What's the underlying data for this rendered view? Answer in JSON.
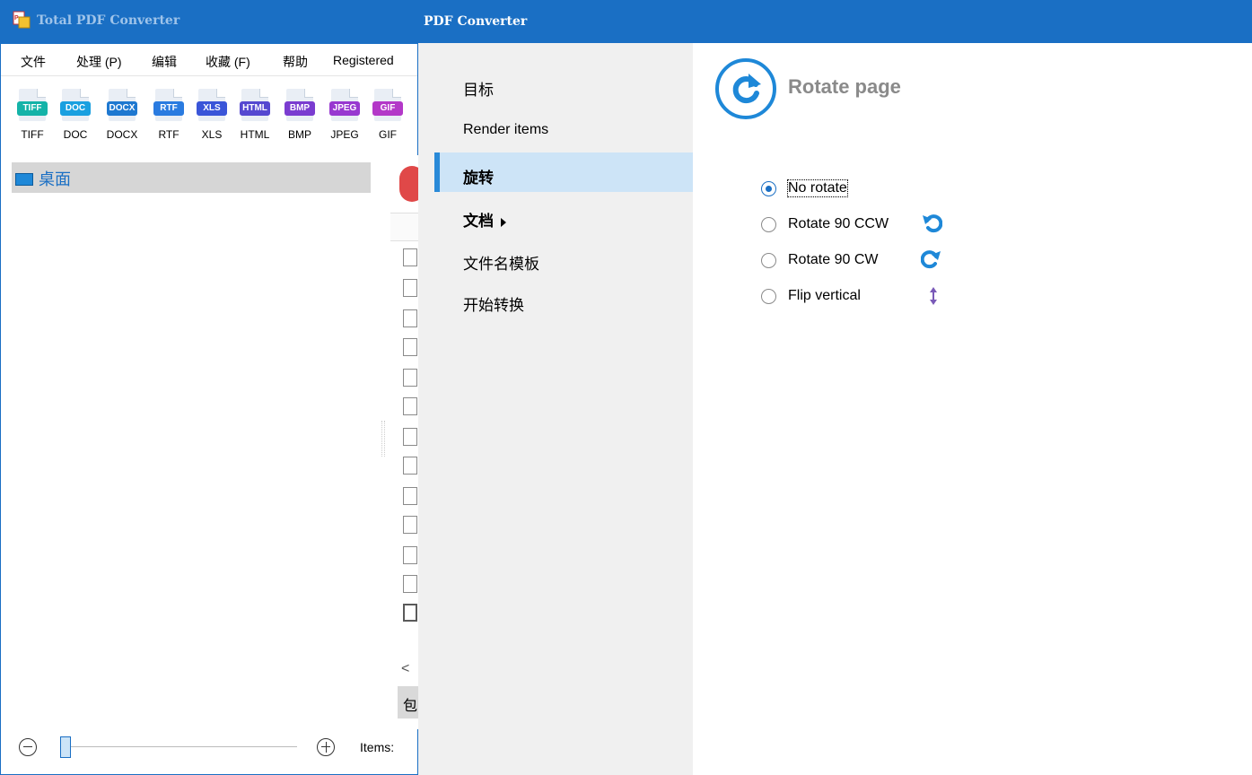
{
  "main_window": {
    "title": "Total PDF Converter",
    "menu": [
      "文件",
      "处理 (P)",
      "编辑",
      "收藏 (F)",
      "帮助",
      "Registered"
    ],
    "formats": [
      {
        "badge": "TIFF",
        "label": "TIFF",
        "color": "#14b3a8"
      },
      {
        "badge": "DOC",
        "label": "DOC",
        "color": "#1aa0e0"
      },
      {
        "badge": "DOCX",
        "label": "DOCX",
        "color": "#1e78d0"
      },
      {
        "badge": "RTF",
        "label": "RTF",
        "color": "#2a7be0"
      },
      {
        "badge": "XLS",
        "label": "XLS",
        "color": "#3a55d8"
      },
      {
        "badge": "HTML",
        "label": "HTML",
        "color": "#5548d0"
      },
      {
        "badge": "BMP",
        "label": "BMP",
        "color": "#7a3cd0"
      },
      {
        "badge": "JPEG",
        "label": "JPEG",
        "color": "#9838d0"
      },
      {
        "badge": "GIF",
        "label": "GIF",
        "color": "#b338c8"
      }
    ],
    "tree": {
      "desktop_label": "桌面"
    },
    "list": {
      "tab_glyph": "包",
      "scroll_left": "<"
    },
    "status": {
      "items_label": "Items:"
    }
  },
  "dialog": {
    "title": "PDF Converter",
    "nav": [
      {
        "label": "目标"
      },
      {
        "label": "Render items"
      },
      {
        "label": "旋转"
      },
      {
        "label": "文档"
      },
      {
        "label": "文件名模板"
      },
      {
        "label": "开始转换"
      }
    ],
    "content": {
      "title": "Rotate page",
      "options": [
        {
          "label": "No rotate",
          "checked": true
        },
        {
          "label": "Rotate 90 CCW",
          "checked": false,
          "icon": "rotate-ccw-icon"
        },
        {
          "label": "Rotate 90 CW",
          "checked": false,
          "icon": "rotate-cw-icon"
        },
        {
          "label": "Flip vertical",
          "checked": false,
          "icon": "flip-vertical-icon"
        }
      ]
    }
  },
  "colors": {
    "accent": "#1a6fc4",
    "nav_selected": "#cde4f7",
    "rotate_icon": "#1e88d8",
    "flip_icon": "#7a5ab8"
  }
}
